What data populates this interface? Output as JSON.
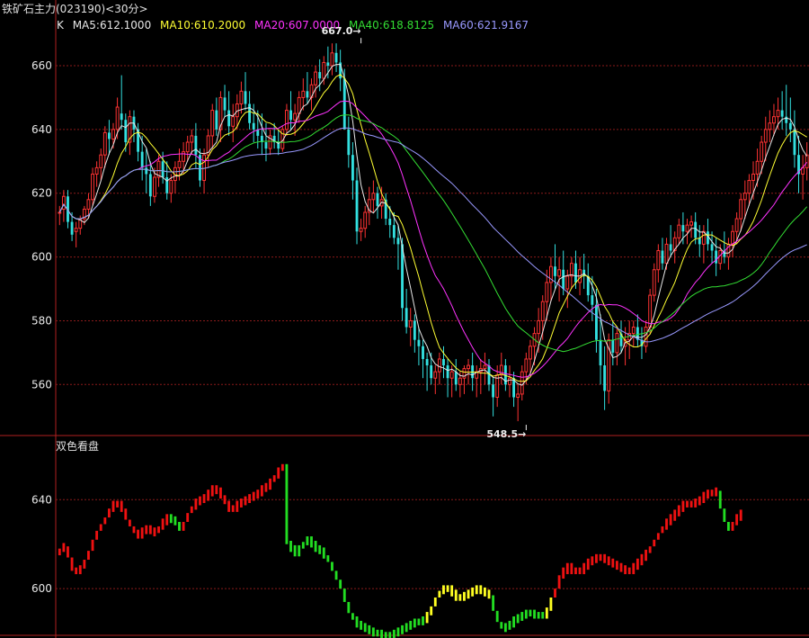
{
  "header": {
    "title": "铁矿石主力(023190)<30分>",
    "k_label": "K"
  },
  "ma_legend": [
    {
      "label": "MA5:612.1000",
      "color": "#e8e8e8"
    },
    {
      "label": "MA10:610.2000",
      "color": "#ffff33"
    },
    {
      "label": "MA20:607.0000",
      "color": "#ff33ff"
    },
    {
      "label": "MA40:618.8125",
      "color": "#33dd33"
    },
    {
      "label": "MA60:621.9167",
      "color": "#9999ff"
    }
  ],
  "sub_panel_title": "双色看盘",
  "colors": {
    "up": "#ff3333",
    "down": "#33e0e0",
    "grid": "#8b1a1a",
    "sub_red": "#ee1111",
    "sub_green": "#22dd22",
    "sub_yellow": "#ffff22"
  },
  "chart_data": [
    {
      "type": "candlestick",
      "title": "",
      "ylim": [
        544,
        671
      ],
      "yticks": [
        560,
        580,
        600,
        620,
        640,
        660
      ],
      "grid": true,
      "annotations": [
        {
          "label": "667.0",
          "value": 667.0,
          "at_bar": 73
        },
        {
          "label": "548.5",
          "value": 548.5,
          "at_bar": 113
        }
      ],
      "ohlc": [
        [
          614,
          616,
          610,
          614
        ],
        [
          615,
          621,
          611,
          619
        ],
        [
          619,
          621,
          609,
          611
        ],
        [
          611,
          614,
          605,
          607
        ],
        [
          608,
          611,
          603,
          609
        ],
        [
          609,
          613,
          607,
          612
        ],
        [
          612,
          616,
          610,
          615
        ],
        [
          615,
          620,
          612,
          618
        ],
        [
          618,
          628,
          616,
          626
        ],
        [
          626,
          630,
          622,
          628
        ],
        [
          628,
          634,
          624,
          632
        ],
        [
          632,
          641,
          628,
          639
        ],
        [
          639,
          643,
          632,
          637
        ],
        [
          637,
          642,
          634,
          640
        ],
        [
          640,
          650,
          637,
          647
        ],
        [
          645,
          657,
          640,
          643
        ],
        [
          643,
          645,
          633,
          636
        ],
        [
          636,
          646,
          632,
          644
        ],
        [
          644,
          646,
          636,
          640
        ],
        [
          640,
          642,
          630,
          633
        ],
        [
          633,
          638,
          624,
          628
        ],
        [
          628,
          634,
          620,
          626
        ],
        [
          626,
          630,
          616,
          619
        ],
        [
          619,
          628,
          617,
          625
        ],
        [
          625,
          632,
          622,
          630
        ],
        [
          630,
          633,
          623,
          625
        ],
        [
          625,
          630,
          618,
          620
        ],
        [
          620,
          626,
          617,
          624
        ],
        [
          624,
          630,
          620,
          628
        ],
        [
          628,
          634,
          624,
          630
        ],
        [
          630,
          636,
          626,
          633
        ],
        [
          633,
          638,
          630,
          636
        ],
        [
          636,
          640,
          632,
          638
        ],
        [
          638,
          642,
          628,
          632
        ],
        [
          632,
          634,
          622,
          624
        ],
        [
          624,
          634,
          620,
          632
        ],
        [
          632,
          640,
          628,
          638
        ],
        [
          638,
          648,
          634,
          646
        ],
        [
          646,
          650,
          638,
          640
        ],
        [
          640,
          652,
          636,
          650
        ],
        [
          650,
          654,
          644,
          646
        ],
        [
          646,
          652,
          638,
          641
        ],
        [
          641,
          648,
          636,
          644
        ],
        [
          644,
          651,
          640,
          648
        ],
        [
          648,
          655,
          645,
          652
        ],
        [
          652,
          658,
          646,
          648
        ],
        [
          648,
          652,
          640,
          642
        ],
        [
          642,
          648,
          636,
          640
        ],
        [
          640,
          646,
          634,
          638
        ],
        [
          638,
          645,
          632,
          636
        ],
        [
          636,
          642,
          630,
          634
        ],
        [
          634,
          640,
          632,
          638
        ],
        [
          638,
          642,
          634,
          636
        ],
        [
          636,
          640,
          632,
          634
        ],
        [
          634,
          641,
          633,
          640
        ],
        [
          640,
          648,
          638,
          646
        ],
        [
          646,
          652,
          640,
          643
        ],
        [
          643,
          648,
          638,
          645
        ],
        [
          645,
          652,
          642,
          650
        ],
        [
          650,
          656,
          646,
          652
        ],
        [
          652,
          658,
          648,
          650
        ],
        [
          650,
          656,
          646,
          654
        ],
        [
          654,
          660,
          650,
          658
        ],
        [
          658,
          662,
          652,
          656
        ],
        [
          656,
          663,
          654,
          661
        ],
        [
          661,
          666,
          656,
          660
        ],
        [
          660,
          667,
          657,
          664
        ],
        [
          664,
          667,
          658,
          661
        ],
        [
          661,
          665,
          652,
          656
        ],
        [
          656,
          659,
          644,
          640
        ],
        [
          640,
          644,
          628,
          632
        ],
        [
          632,
          636,
          618,
          624
        ],
        [
          624,
          628,
          604,
          608
        ],
        [
          608,
          612,
          605,
          609
        ],
        [
          609,
          616,
          606,
          614
        ],
        [
          614,
          622,
          610,
          618
        ],
        [
          618,
          624,
          614,
          620
        ],
        [
          620,
          622,
          612,
          616
        ],
        [
          616,
          622,
          612,
          618
        ],
        [
          618,
          620,
          610,
          612
        ],
        [
          612,
          616,
          606,
          610
        ],
        [
          610,
          614,
          604,
          606
        ],
        [
          606,
          610,
          596,
          604
        ],
        [
          604,
          606,
          580,
          584
        ],
        [
          584,
          590,
          576,
          578
        ],
        [
          578,
          584,
          572,
          580
        ],
        [
          580,
          582,
          570,
          574
        ],
        [
          574,
          578,
          566,
          572
        ],
        [
          572,
          574,
          562,
          568
        ],
        [
          568,
          570,
          558,
          566
        ],
        [
          566,
          570,
          560,
          562
        ],
        [
          562,
          566,
          557,
          564
        ],
        [
          564,
          570,
          560,
          568
        ],
        [
          568,
          572,
          562,
          566
        ],
        [
          566,
          568,
          556,
          562
        ],
        [
          562,
          566,
          556,
          564
        ],
        [
          564,
          568,
          558,
          560
        ],
        [
          560,
          564,
          556,
          562
        ],
        [
          562,
          566,
          557,
          565
        ],
        [
          565,
          568,
          560,
          566
        ],
        [
          566,
          570,
          558,
          562
        ],
        [
          562,
          566,
          556,
          564
        ],
        [
          564,
          568,
          557,
          565
        ],
        [
          565,
          570,
          560,
          566
        ],
        [
          566,
          568,
          558,
          560
        ],
        [
          560,
          562,
          550,
          556
        ],
        [
          556,
          566,
          553,
          563
        ],
        [
          563,
          570,
          560,
          566
        ],
        [
          566,
          568,
          558,
          560
        ],
        [
          560,
          566,
          556,
          562
        ],
        [
          562,
          564,
          553,
          556
        ],
        [
          556,
          560,
          548.5,
          557
        ],
        [
          557,
          566,
          555,
          564
        ],
        [
          564,
          570,
          560,
          568
        ],
        [
          568,
          574,
          563,
          572
        ],
        [
          572,
          578,
          566,
          576
        ],
        [
          576,
          584,
          570,
          580
        ],
        [
          580,
          588,
          574,
          586
        ],
        [
          586,
          596,
          580,
          592
        ],
        [
          592,
          600,
          586,
          597
        ],
        [
          597,
          604,
          590,
          594
        ],
        [
          594,
          600,
          586,
          596
        ],
        [
          596,
          602,
          588,
          590
        ],
        [
          590,
          596,
          584,
          594
        ],
        [
          594,
          600,
          590,
          598
        ],
        [
          598,
          602,
          590,
          592
        ],
        [
          592,
          600,
          588,
          596
        ],
        [
          596,
          601,
          590,
          594
        ],
        [
          594,
          598,
          586,
          588
        ],
        [
          588,
          594,
          580,
          585
        ],
        [
          585,
          590,
          570,
          574
        ],
        [
          574,
          582,
          560,
          566
        ],
        [
          566,
          572,
          552,
          558
        ],
        [
          558,
          576,
          554,
          574
        ],
        [
          574,
          580,
          566,
          570
        ],
        [
          570,
          578,
          566,
          576
        ],
        [
          576,
          580,
          570,
          572
        ],
        [
          572,
          578,
          566,
          574
        ],
        [
          574,
          580,
          568,
          576
        ],
        [
          576,
          580,
          572,
          578
        ],
        [
          578,
          582,
          572,
          574
        ],
        [
          574,
          578,
          568,
          572
        ],
        [
          572,
          580,
          570,
          578
        ],
        [
          578,
          590,
          576,
          588
        ],
        [
          588,
          598,
          586,
          596
        ],
        [
          596,
          604,
          592,
          602
        ],
        [
          602,
          606,
          596,
          598
        ],
        [
          598,
          606,
          596,
          604
        ],
        [
          604,
          610,
          600,
          602
        ],
        [
          602,
          608,
          598,
          606
        ],
        [
          606,
          612,
          604,
          610
        ],
        [
          610,
          614,
          604,
          608
        ],
        [
          608,
          612,
          604,
          610
        ],
        [
          610,
          613,
          606,
          611
        ],
        [
          611,
          614,
          604,
          606
        ],
        [
          606,
          610,
          600,
          604
        ],
        [
          604,
          610,
          598,
          608
        ],
        [
          608,
          612,
          602,
          604
        ],
        [
          604,
          608,
          598,
          602
        ],
        [
          602,
          606,
          594,
          598
        ],
        [
          598,
          604,
          596,
          602
        ],
        [
          602,
          608,
          598,
          600
        ],
        [
          600,
          606,
          596,
          604
        ],
        [
          604,
          610,
          600,
          608
        ],
        [
          608,
          614,
          604,
          612
        ],
        [
          612,
          620,
          608,
          618
        ],
        [
          618,
          624,
          612,
          620
        ],
        [
          620,
          626,
          616,
          624
        ],
        [
          624,
          630,
          618,
          626
        ],
        [
          626,
          634,
          622,
          630
        ],
        [
          630,
          638,
          626,
          636
        ],
        [
          636,
          644,
          630,
          640
        ],
        [
          640,
          646,
          636,
          642
        ],
        [
          642,
          648,
          638,
          644
        ],
        [
          644,
          650,
          640,
          646
        ],
        [
          646,
          652,
          640,
          644
        ],
        [
          644,
          654,
          638,
          642
        ],
        [
          642,
          650,
          636,
          640
        ],
        [
          640,
          646,
          628,
          632
        ],
        [
          632,
          638,
          620,
          626
        ],
        [
          626,
          632,
          618,
          628
        ],
        [
          628,
          636,
          624,
          632
        ]
      ]
    },
    {
      "type": "bar",
      "title": "双色看盘",
      "ylim": [
        579,
        664
      ],
      "yticks": [
        600,
        640
      ],
      "grid": true,
      "legend": "none",
      "segments": [
        {
          "color": "red",
          "values": [
            618,
            619,
            614,
            608,
            608,
            609,
            613,
            617,
            622,
            626,
            629,
            632,
            636,
            638,
            638,
            636,
            631,
            628,
            625,
            624,
            626,
            627,
            626,
            625,
            628,
            630,
            632
          ]
        },
        {
          "color": "green",
          "values": [
            631,
            630,
            626
          ]
        },
        {
          "color": "red",
          "values": [
            630,
            634,
            637,
            639,
            640,
            641,
            643,
            645,
            644,
            642,
            638,
            636,
            636,
            638,
            639,
            640,
            641,
            642,
            643,
            645,
            646,
            648,
            651,
            653,
            656
          ]
        },
        {
          "color": "green",
          "values": [
            620,
            618,
            616,
            618,
            621,
            622,
            620,
            618,
            617,
            615,
            612,
            608,
            604,
            600,
            594,
            589,
            586,
            584,
            583,
            582,
            581,
            580,
            580,
            579,
            579,
            579,
            580,
            581,
            582,
            583,
            584,
            585,
            585,
            586
          ]
        },
        {
          "color": "yellow",
          "values": [
            588,
            592,
            596,
            599,
            600,
            600,
            598,
            596,
            596,
            597,
            598,
            599,
            600,
            599,
            598,
            597
          ]
        },
        {
          "color": "green",
          "values": [
            590,
            585,
            582,
            583,
            584,
            586,
            587,
            588,
            589,
            589,
            588,
            588,
            588
          ]
        },
        {
          "color": "yellow",
          "values": [
            590,
            596
          ]
        },
        {
          "color": "red",
          "values": [
            600,
            606,
            608,
            610,
            608,
            608,
            608,
            610,
            612,
            613,
            614,
            614,
            613,
            612,
            611,
            610,
            609,
            608,
            608,
            610,
            612,
            614,
            616,
            619,
            622,
            625,
            628,
            630,
            632,
            634,
            636,
            638,
            638,
            638,
            639,
            640,
            642,
            643,
            643,
            644
          ]
        },
        {
          "color": "green",
          "values": [
            636,
            630,
            626
          ]
        },
        {
          "color": "red",
          "values": [
            630,
            632,
            634
          ]
        }
      ]
    }
  ]
}
